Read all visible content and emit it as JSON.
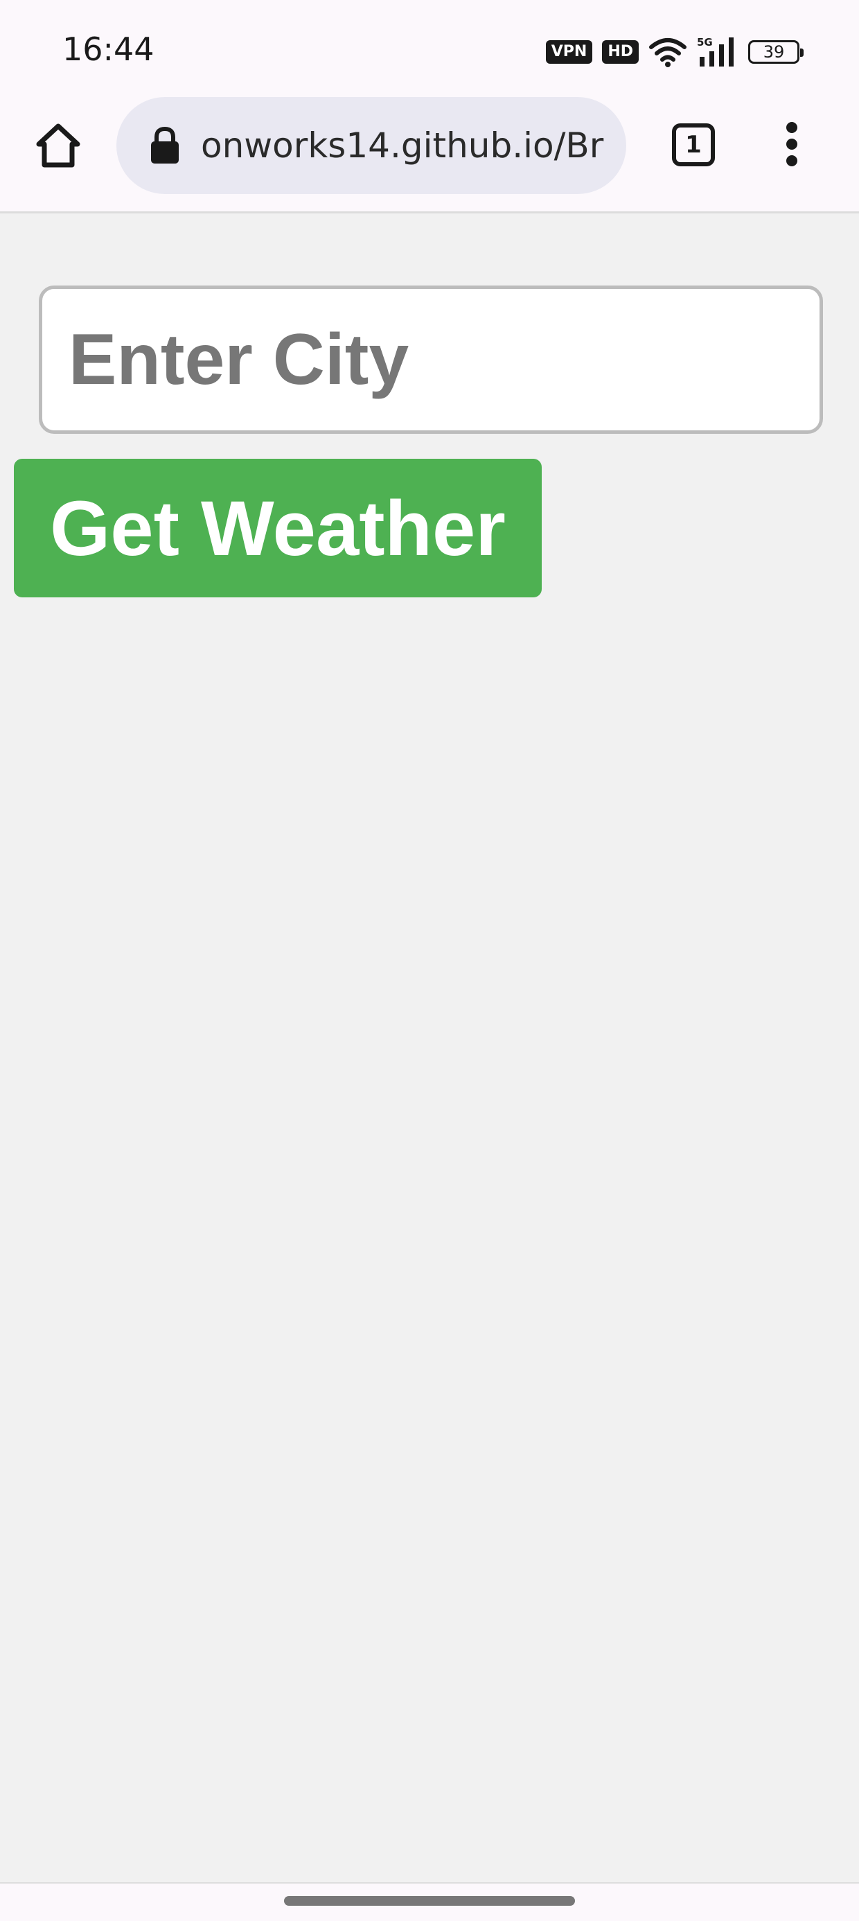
{
  "status_bar": {
    "time": "16:44",
    "vpn_badge": "VPN",
    "hd_badge": "HD",
    "network": "5G",
    "battery": "39"
  },
  "browser": {
    "url": "onworks14.github.io/Br",
    "tab_count": "1",
    "icons": [
      "home-icon",
      "lock-icon",
      "tabs-icon",
      "more-vert-icon"
    ]
  },
  "page": {
    "city_input": {
      "placeholder": "Enter City",
      "value": ""
    },
    "get_weather_label": "Get Weather"
  },
  "colors": {
    "page_background": "#f1f1f1",
    "button_green": "#4eb152",
    "browser_chrome": "#fcf8fc",
    "url_pill": "#e9e8f2"
  }
}
